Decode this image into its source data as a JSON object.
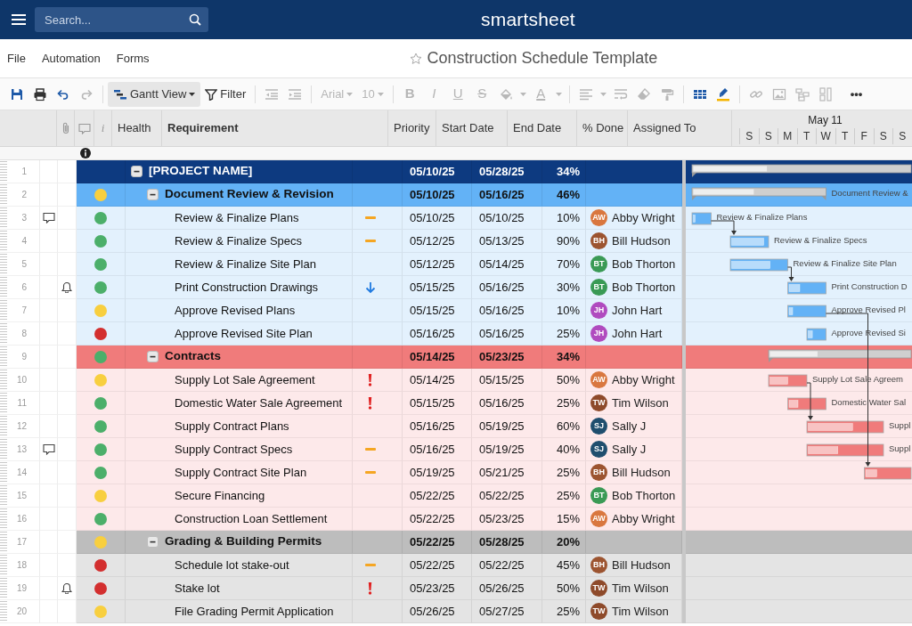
{
  "topbar": {
    "search": {
      "placeholder": "Search..."
    },
    "logo": "smartsheet"
  },
  "menu": [
    "File",
    "Automation",
    "Forms"
  ],
  "title": {
    "text": "Construction Schedule Template",
    "favorite": false
  },
  "toolbar": [
    {
      "kind": "save",
      "disabled": false
    },
    {
      "kind": "print",
      "disabled": false
    },
    {
      "kind": "undo",
      "disabled": false
    },
    {
      "kind": "redo",
      "disabled": true
    },
    {
      "kind": "separator"
    },
    {
      "kind": "view",
      "label": "Gantt View",
      "disabled": false
    },
    {
      "kind": "filter",
      "label": "Filter",
      "disabled": false
    },
    {
      "kind": "separator"
    },
    {
      "kind": "outdent",
      "disabled": true
    },
    {
      "kind": "indent",
      "disabled": true
    },
    {
      "kind": "separator"
    },
    {
      "kind": "dropdown",
      "label": "Arial",
      "disabled": true
    },
    {
      "kind": "dropdown",
      "label": "10",
      "disabled": true
    },
    {
      "kind": "separator"
    },
    {
      "kind": "bold",
      "label": "B",
      "disabled": true
    },
    {
      "kind": "italic",
      "label": "I",
      "disabled": true
    },
    {
      "kind": "underline",
      "label": "U",
      "disabled": true
    },
    {
      "kind": "strike",
      "label": "S",
      "disabled": true
    },
    {
      "kind": "fill",
      "disabled": true
    },
    {
      "kind": "textcolor",
      "label": "A",
      "disabled": true
    },
    {
      "kind": "separator"
    },
    {
      "kind": "align",
      "disabled": true
    },
    {
      "kind": "wrap",
      "disabled": true
    },
    {
      "kind": "eraser",
      "disabled": true
    },
    {
      "kind": "painter",
      "disabled": true
    },
    {
      "kind": "separator"
    },
    {
      "kind": "cardview",
      "disabled": false
    },
    {
      "kind": "highlight",
      "disabled": false
    },
    {
      "kind": "separator"
    },
    {
      "kind": "link",
      "disabled": true
    },
    {
      "kind": "image",
      "disabled": true
    },
    {
      "kind": "hierarchy",
      "disabled": true
    },
    {
      "kind": "column",
      "disabled": true
    },
    {
      "kind": "more",
      "label": "•••",
      "disabled": false
    }
  ],
  "columns": [
    {
      "kind": "attachment"
    },
    {
      "kind": "comment"
    },
    {
      "kind": "info",
      "label": "i"
    },
    {
      "kind": "text",
      "label": "Health",
      "primary": false
    },
    {
      "kind": "text",
      "label": "Requirement",
      "primary": true
    },
    {
      "kind": "text",
      "label": "Priority",
      "primary": false
    },
    {
      "kind": "text",
      "label": "Start Date",
      "primary": false
    },
    {
      "kind": "text",
      "label": "End Date",
      "primary": false
    },
    {
      "kind": "text",
      "label": "% Done",
      "primary": false
    },
    {
      "kind": "text",
      "label": "Assigned To",
      "primary": false
    }
  ],
  "gantt": {
    "month": "May 11",
    "days": [
      "S",
      "S",
      "M",
      "T",
      "W",
      "T",
      "F",
      "S",
      "S"
    ]
  },
  "project": {
    "num": "1",
    "name": "[PROJECT NAME]",
    "start": "05/10/25",
    "end": "05/28/25",
    "done": "34%",
    "expanded": true,
    "color": "#0d3a80",
    "sections": [
      {
        "num": "2",
        "name": "Document Review & Revision",
        "health": {
          "color": "#f8cf3f"
        },
        "start": "05/10/25",
        "end": "05/16/25",
        "done": "46%",
        "expanded": true,
        "color": "#63b2f6",
        "row_fill": {
          "color": "#e3f1fd"
        },
        "gantt_label": "Document Review &",
        "tasks": [
          {
            "num": "3",
            "comment": true,
            "health": {
              "color": "#4caf6a"
            },
            "name": "Review & Finalize Plans",
            "priority": {
              "kind": "medium"
            },
            "link_out": true,
            "start": "05/10/25",
            "end": "05/10/25",
            "done": "10%",
            "assignee": {
              "initials": "AW",
              "name": "Abby Wright",
              "color": "#d9773f"
            },
            "gantt_label": "Review & Finalize Plans"
          },
          {
            "num": "4",
            "health": {
              "color": "#4caf6a"
            },
            "name": "Review & Finalize Specs",
            "priority": {
              "kind": "medium"
            },
            "link_in": true,
            "start": "05/12/25",
            "end": "05/13/25",
            "done": "90%",
            "assignee": {
              "initials": "BH",
              "name": "Bill Hudson",
              "color": "#9c5430"
            },
            "gantt_label": "Review & Finalize Specs"
          },
          {
            "num": "5",
            "health": {
              "color": "#4caf6a"
            },
            "name": "Review & Finalize Site Plan",
            "link_out": true,
            "start": "05/12/25",
            "end": "05/14/25",
            "done": "70%",
            "assignee": {
              "initials": "BT",
              "name": "Bob Thorton",
              "color": "#3a9a55"
            },
            "gantt_label": "Review & Finalize Site Plan"
          },
          {
            "num": "6",
            "reminder": true,
            "health": {
              "color": "#4caf6a"
            },
            "name": "Print Construction Drawings",
            "priority": {
              "kind": "low"
            },
            "link_in": true,
            "start": "05/15/25",
            "end": "05/16/25",
            "done": "30%",
            "assignee": {
              "initials": "BT",
              "name": "Bob Thorton",
              "color": "#3a9a55"
            },
            "gantt_label": "Print Construction D"
          },
          {
            "num": "7",
            "health": {
              "color": "#f8cf3f"
            },
            "name": "Approve Revised Plans",
            "link_out": true,
            "start": "05/15/25",
            "end": "05/16/25",
            "done": "10%",
            "assignee": {
              "initials": "JH",
              "name": "John Hart",
              "color": "#b04bbf"
            },
            "gantt_label": "Approve Revised Pl"
          },
          {
            "num": "8",
            "health": {
              "color": "#d32f2f"
            },
            "name": "Approve Revised Site Plan",
            "start": "05/16/25",
            "end": "05/16/25",
            "done": "25%",
            "assignee": {
              "initials": "JH",
              "name": "John Hart",
              "color": "#b04bbf"
            },
            "gantt_label": "Approve Revised Si"
          }
        ]
      },
      {
        "num": "9",
        "name": "Contracts",
        "health": {
          "color": "#4caf6a"
        },
        "start": "05/14/25",
        "end": "05/23/25",
        "done": "34%",
        "expanded": true,
        "color": "#f07b7b",
        "row_fill": {
          "color": "#fde9ea"
        },
        "tasks": [
          {
            "num": "10",
            "health": {
              "color": "#f8cf3f"
            },
            "name": "Supply Lot Sale Agreement",
            "priority": {
              "kind": "high"
            },
            "link_out": true,
            "start": "05/14/25",
            "end": "05/15/25",
            "done": "50%",
            "assignee": {
              "initials": "AW",
              "name": "Abby Wright",
              "color": "#d9773f"
            },
            "gantt_label": "Supply Lot Sale Agreem"
          },
          {
            "num": "11",
            "health": {
              "color": "#4caf6a"
            },
            "name": "Domestic Water Sale Agreement",
            "priority": {
              "kind": "high"
            },
            "start": "05/15/25",
            "end": "05/16/25",
            "done": "25%",
            "assignee": {
              "initials": "TW",
              "name": "Tim Wilson",
              "color": "#8e4a2a"
            },
            "gantt_label": "Domestic Water Sal"
          },
          {
            "num": "12",
            "health": {
              "color": "#4caf6a"
            },
            "name": "Supply Contract Plans",
            "link_in": true,
            "start": "05/16/25",
            "end": "05/19/25",
            "done": "60%",
            "assignee": {
              "initials": "SJ",
              "name": "Sally J",
              "color": "#1f4e6e"
            },
            "gantt_label": "Suppl"
          },
          {
            "num": "13",
            "comment": true,
            "health": {
              "color": "#4caf6a"
            },
            "name": "Supply Contract Specs",
            "priority": {
              "kind": "medium"
            },
            "start": "05/16/25",
            "end": "05/19/25",
            "done": "40%",
            "assignee": {
              "initials": "SJ",
              "name": "Sally J",
              "color": "#1f4e6e"
            },
            "gantt_label": "Suppl"
          },
          {
            "num": "14",
            "health": {
              "color": "#4caf6a"
            },
            "name": "Supply Contract Site Plan",
            "priority": {
              "kind": "medium"
            },
            "link_in": true,
            "start": "05/19/25",
            "end": "05/21/25",
            "done": "25%",
            "assignee": {
              "initials": "BH",
              "name": "Bill Hudson",
              "color": "#9c5430"
            }
          },
          {
            "num": "15",
            "health": {
              "color": "#f8cf3f"
            },
            "name": "Secure Financing",
            "start": "05/22/25",
            "end": "05/22/25",
            "done": "25%",
            "assignee": {
              "initials": "BT",
              "name": "Bob Thorton",
              "color": "#3a9a55"
            }
          },
          {
            "num": "16",
            "health": {
              "color": "#4caf6a"
            },
            "name": "Construction Loan Settlement",
            "start": "05/22/25",
            "end": "05/23/25",
            "done": "15%",
            "assignee": {
              "initials": "AW",
              "name": "Abby Wright",
              "color": "#d9773f"
            }
          }
        ]
      },
      {
        "num": "17",
        "name": "Grading & Building Permits",
        "health": {
          "color": "#f8cf3f"
        },
        "start": "05/22/25",
        "end": "05/28/25",
        "done": "20%",
        "expanded": true,
        "color": "#bdbdbd",
        "row_fill": {
          "color": "#e4e4e4"
        },
        "tasks": [
          {
            "num": "18",
            "health": {
              "color": "#d32f2f"
            },
            "name": "Schedule lot stake-out",
            "priority": {
              "kind": "medium"
            },
            "start": "05/22/25",
            "end": "05/22/25",
            "done": "45%",
            "assignee": {
              "initials": "BH",
              "name": "Bill Hudson",
              "color": "#9c5430"
            }
          },
          {
            "num": "19",
            "reminder": true,
            "health": {
              "color": "#d32f2f"
            },
            "name": "Stake lot",
            "priority": {
              "kind": "high"
            },
            "start": "05/23/25",
            "end": "05/26/25",
            "done": "50%",
            "assignee": {
              "initials": "TW",
              "name": "Tim Wilson",
              "color": "#8e4a2a"
            }
          },
          {
            "num": "20",
            "health": {
              "color": "#f8cf3f"
            },
            "name": "File Grading Permit Application",
            "start": "05/26/25",
            "end": "05/27/25",
            "done": "25%",
            "assignee": {
              "initials": "TW",
              "name": "Tim Wilson",
              "color": "#8e4a2a"
            }
          }
        ]
      }
    ]
  }
}
